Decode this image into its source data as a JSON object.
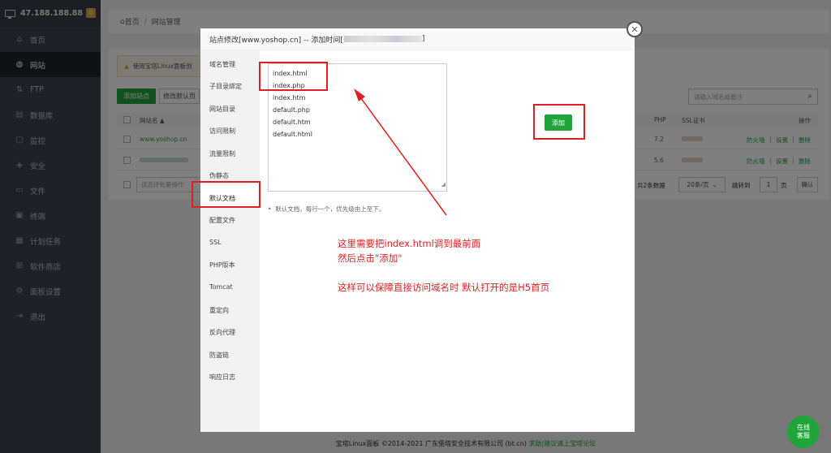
{
  "server": {
    "ip": "47.188.188.88",
    "badge": "0"
  },
  "sidebar": {
    "items": [
      {
        "label": "首页",
        "icon": "home-icon"
      },
      {
        "label": "网站",
        "icon": "globe-icon"
      },
      {
        "label": "FTP",
        "icon": "ftp-icon"
      },
      {
        "label": "数据库",
        "icon": "database-icon"
      },
      {
        "label": "监控",
        "icon": "monitor-icon"
      },
      {
        "label": "安全",
        "icon": "shield-icon"
      },
      {
        "label": "文件",
        "icon": "folder-icon"
      },
      {
        "label": "终端",
        "icon": "terminal-icon"
      },
      {
        "label": "计划任务",
        "icon": "calendar-icon"
      },
      {
        "label": "软件商店",
        "icon": "apps-icon"
      },
      {
        "label": "面板设置",
        "icon": "gear-icon"
      },
      {
        "label": "退出",
        "icon": "logout-icon"
      }
    ]
  },
  "breadcrumb": {
    "home": "首页",
    "sep": "/",
    "current": "网站管理"
  },
  "page": {
    "warning": "使用宝塔Linux面板创",
    "add_site": "添加站点",
    "modify_default": "修改默认页",
    "search_placeholder": "请输入域名或备注",
    "table": {
      "headers": {
        "name": "网站名 ▲",
        "php": "PHP",
        "ssl": "SSL证书",
        "ops": "操作"
      },
      "rows": [
        {
          "name": "www.yoshop.cn",
          "php": "7.2",
          "ops": [
            "防火墙",
            "设置",
            "删除"
          ]
        },
        {
          "name": "",
          "php": "5.6",
          "ops": [
            "防火墙",
            "设置",
            "删除"
          ]
        }
      ]
    },
    "bulk_placeholder": "请选择批量操作",
    "pagination": {
      "total": "共2条数据",
      "per_page": "20条/页",
      "jump": "跳转到",
      "page_num": "1",
      "page_unit": "页",
      "confirm": "确认"
    }
  },
  "modal": {
    "title": "站点修改[www.yoshop.cn] -- 添加时间[",
    "title_end": "]",
    "nav": [
      "域名管理",
      "子目录绑定",
      "网站目录",
      "访问限制",
      "流量限制",
      "伪静态",
      "默认文档",
      "配置文件",
      "SSL",
      "PHP版本",
      "Tomcat",
      "重定向",
      "反向代理",
      "防盗链",
      "响应日志"
    ],
    "default_docs": [
      "index.html",
      "index.php",
      "index.htm",
      "default.php",
      "default.htm",
      "default.html"
    ],
    "hint": "默认文档，每行一个，优先级由上至下。",
    "add_button": "添加"
  },
  "annotation": {
    "line1": "这里需要把index.html调到最前面",
    "line2": "然后点击\"添加\"",
    "line3": "这样可以保障直接访问域名时 默认打开的是H5首页"
  },
  "footer": {
    "text": "宝塔Linux面板 ©2014-2021 广东堡塔安全技术有限公司 (bt.cn)",
    "link": "求助|建议请上宝塔论坛"
  },
  "online_service": {
    "line1": "在线",
    "line2": "客服"
  },
  "colors": {
    "accent": "#20a53a",
    "sidebar": "#3c444d",
    "annotation": "#e02020"
  }
}
